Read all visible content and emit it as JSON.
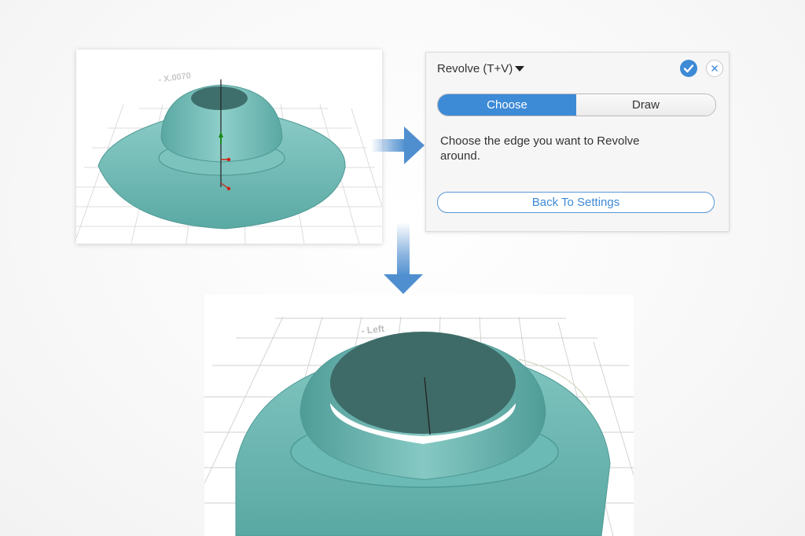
{
  "panel": {
    "title": "Revolve (T+V)",
    "tabs": [
      {
        "label": "Choose",
        "active": true
      },
      {
        "label": "Draw",
        "active": false
      }
    ],
    "instruction": "Choose the edge you want to Revolve around.",
    "back_button": "Back To Settings",
    "accent_color": "#3d8ad6"
  },
  "viewport_top": {
    "watermark": "- X.0070"
  },
  "viewport_bottom": {
    "watermark": "- Left"
  },
  "model_color": "#6bbab5",
  "icons": {
    "confirm": "checkmark-icon",
    "close": "close-icon",
    "dropdown": "caret-down-icon",
    "arrow_right": "arrow-right-icon",
    "arrow_down": "arrow-down-icon"
  }
}
